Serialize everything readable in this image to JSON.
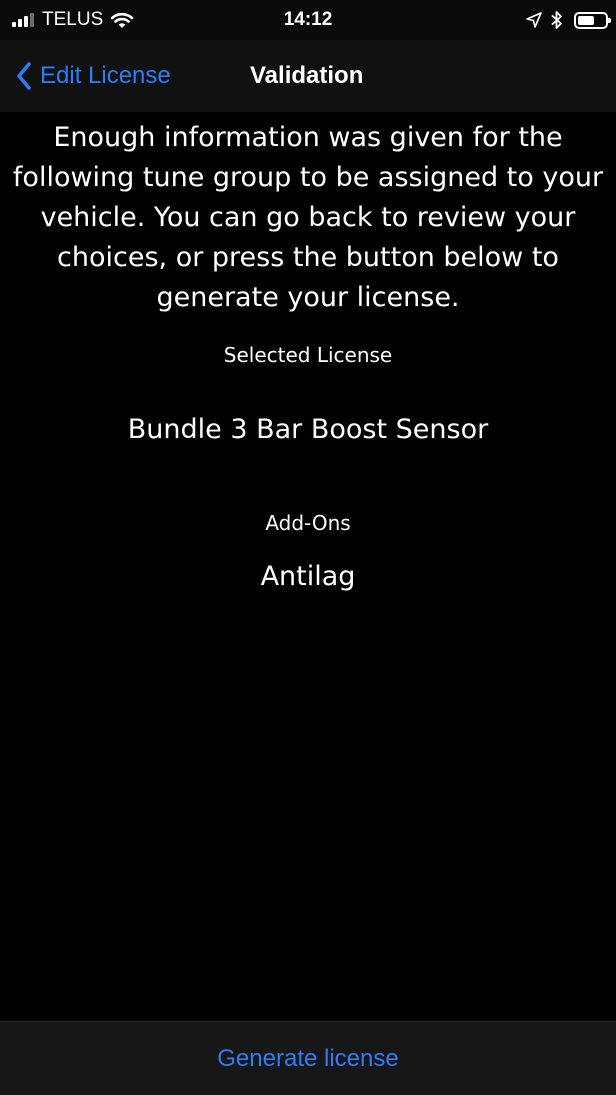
{
  "status_bar": {
    "carrier": "TELUS",
    "time": "14:12",
    "signal_bars_filled": 3,
    "signal_bars_total": 4,
    "battery_level": 0.6,
    "icons": [
      "signal-icon",
      "wifi-icon",
      "location-arrow-icon",
      "bluetooth-icon",
      "battery-icon"
    ]
  },
  "nav": {
    "back_label": "Edit License",
    "title": "Validation"
  },
  "content": {
    "intro": "Enough information was given for the following tune group to be assigned to your vehicle. You can go back to review your choices, or press the button below to generate your license.",
    "selected_license_heading": "Selected License",
    "selected_license_value": "Bundle 3 Bar Boost Sensor",
    "addons_heading": "Add-Ons",
    "addons_value": "Antilag"
  },
  "toolbar": {
    "generate_label": "Generate license"
  },
  "colors": {
    "accent": "#2f7cf6",
    "background": "#000000",
    "bar_background": "#111111",
    "text": "#ffffff"
  }
}
